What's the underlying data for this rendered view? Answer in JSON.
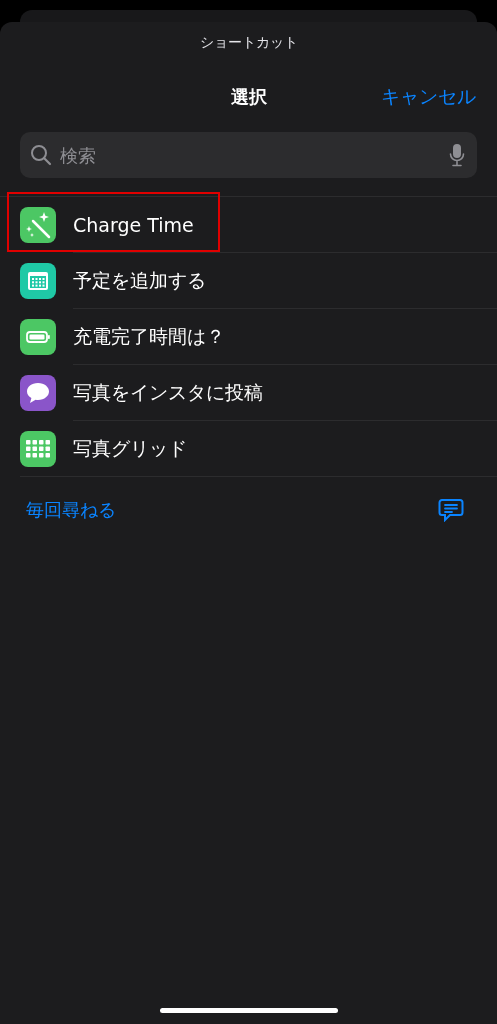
{
  "sheet": {
    "caption": "ショートカット",
    "title": "選択",
    "cancel": "キャンセル"
  },
  "search": {
    "placeholder": "検索"
  },
  "shortcuts": [
    {
      "label": "Charge Time",
      "kind": "wand",
      "color": "#4cc764",
      "highlighted": true
    },
    {
      "label": "予定を追加する",
      "kind": "calendar",
      "color": "#1fc9a6",
      "highlighted": false
    },
    {
      "label": "充電完了時間は？",
      "kind": "battery",
      "color": "#4cc764",
      "highlighted": false
    },
    {
      "label": "写真をインスタに投稿",
      "kind": "message",
      "color": "#8a55c9",
      "highlighted": false
    },
    {
      "label": "写真グリッド",
      "kind": "grid",
      "color": "#4cc764",
      "highlighted": false
    }
  ],
  "footer": {
    "ask_each_time": "毎回尋ねる"
  }
}
